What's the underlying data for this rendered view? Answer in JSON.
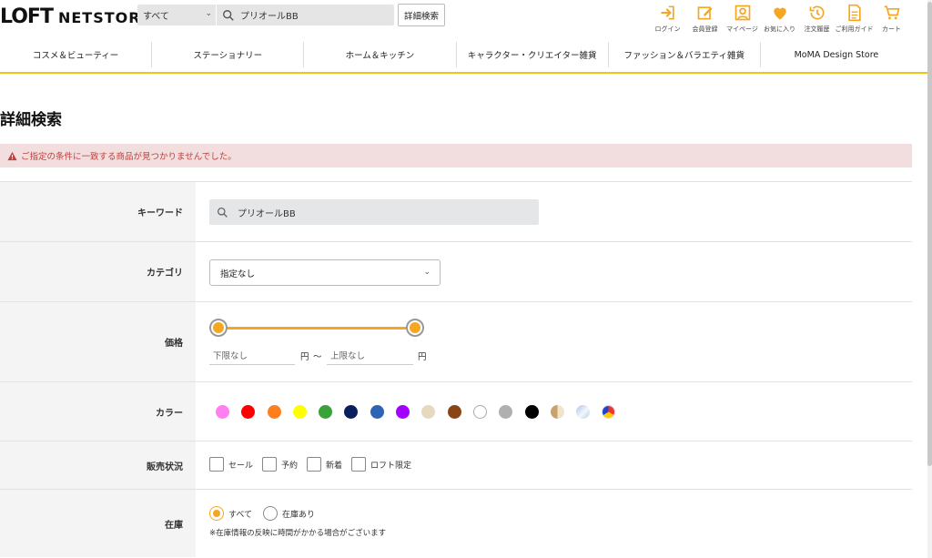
{
  "header": {
    "logo_mark": "LOFT",
    "logo_text": "NETSTORE",
    "search_scope": "すべて",
    "search_value": "プリオールBB",
    "advanced_button": "詳細検索",
    "icons": [
      {
        "name": "login-icon",
        "label": "ログイン"
      },
      {
        "name": "register-icon",
        "label": "会員登録"
      },
      {
        "name": "mypage-icon",
        "label": "マイページ"
      },
      {
        "name": "favorite-icon",
        "label": "お気に入り"
      },
      {
        "name": "order-history-icon",
        "label": "注文履歴"
      },
      {
        "name": "guide-icon",
        "label": "ご利用ガイド"
      },
      {
        "name": "cart-icon",
        "label": "カート"
      }
    ]
  },
  "nav": [
    "コスメ＆ビューティー",
    "ステーショナリー",
    "ホーム＆キッチン",
    "キャラクター・クリエイター雑貨",
    "ファッション＆バラエティ雑貨",
    "MoMA Design Store"
  ],
  "page": {
    "title": "詳細検索",
    "alert": "ご指定の条件に一致する商品が見つかりませんでした。"
  },
  "form": {
    "keyword_label": "キーワード",
    "keyword_value": "プリオールBB",
    "category_label": "カテゴリ",
    "category_value": "指定なし",
    "price_label": "価格",
    "price_min_placeholder": "下限なし",
    "price_max_placeholder": "上限なし",
    "price_unit": "円",
    "price_tilde": "～",
    "price_range_fraction": [
      0,
      1
    ],
    "color_label": "カラー",
    "colors": [
      "#ff7ff0",
      "#ff0000",
      "#ff7f1e",
      "#ffff00",
      "#39a339",
      "#0b1f5c",
      "#2e64b4",
      "#a200ff",
      "#e6d9c0",
      "#8b4514",
      "#ffffff",
      "#b0b0b0",
      "#000000",
      "gold",
      "silver",
      "multi"
    ],
    "status_label": "販売状況",
    "status_options": [
      "セール",
      "予約",
      "新着",
      "ロフト限定"
    ],
    "stock_label": "在庫",
    "stock_options": [
      "すべて",
      "在庫あり"
    ],
    "stock_selected": "すべて",
    "stock_note": "※在庫情報の反映に時間がかかる場合がございます"
  },
  "colors": {
    "accent": "#f5a623",
    "nav_underline": "#f0c419",
    "alert_bg": "#f2dede",
    "alert_text": "#b9413f",
    "icon_orange": "#f5a623"
  }
}
